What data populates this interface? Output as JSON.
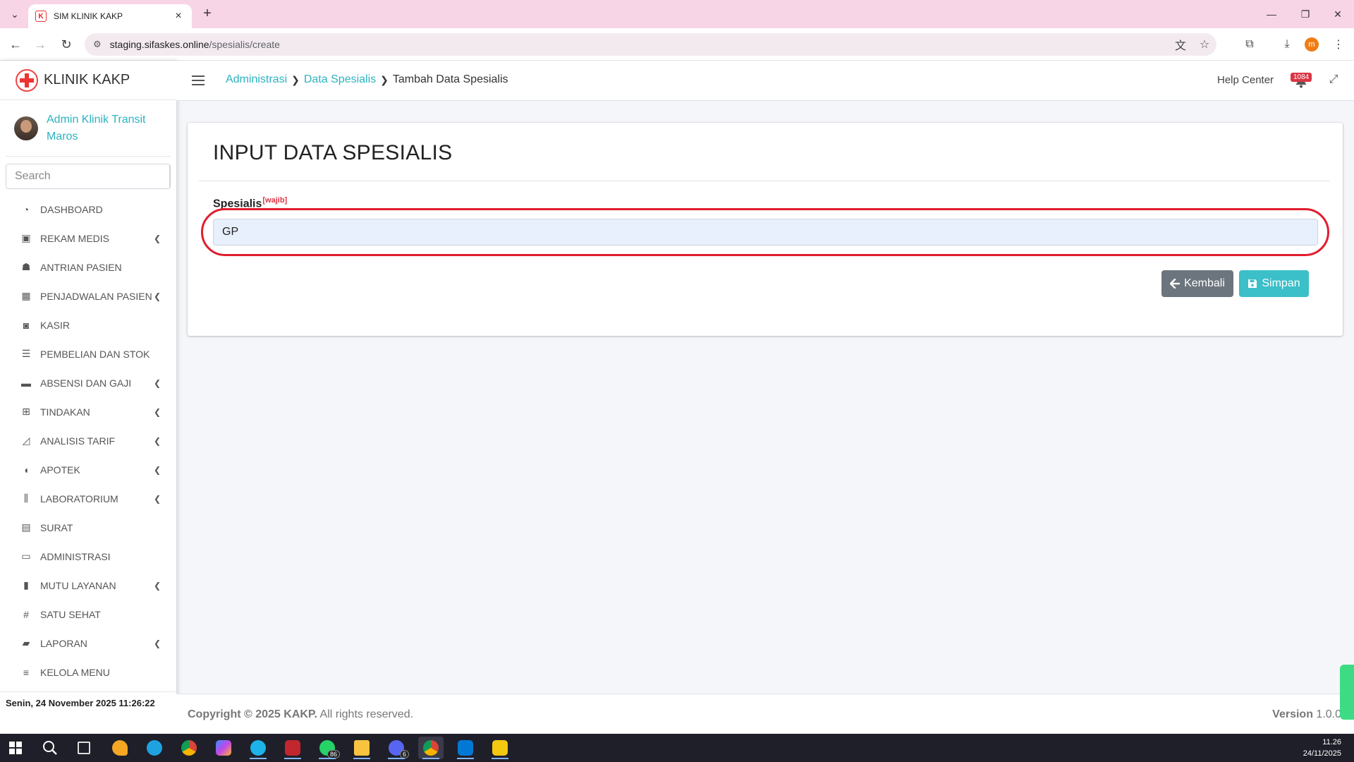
{
  "browser": {
    "tab_title": "SIM KLINIK KAKP",
    "favicon_text": "K",
    "url_host": "staging.sifaskes.online",
    "url_path": "/spesialis/create",
    "profile_initial": "m"
  },
  "sidebar": {
    "brand": "KLINIK KAKP",
    "user_name": "Admin Klinik Transit Maros",
    "search_placeholder": "Search",
    "items": [
      {
        "label": "DASHBOARD",
        "icon": "dashboard-icon",
        "chevron": false
      },
      {
        "label": "REKAM MEDIS",
        "icon": "medical-record-icon",
        "chevron": true
      },
      {
        "label": "ANTRIAN PASIEN",
        "icon": "queue-icon",
        "chevron": false
      },
      {
        "label": "PENJADWALAN PASIEN",
        "icon": "calendar-icon",
        "chevron": true
      },
      {
        "label": "KASIR",
        "icon": "cash-icon",
        "chevron": false
      },
      {
        "label": "PEMBELIAN DAN STOK",
        "icon": "list-icon",
        "chevron": false
      },
      {
        "label": "ABSENSI DAN GAJI",
        "icon": "wallet-icon",
        "chevron": true
      },
      {
        "label": "TINDAKAN",
        "icon": "medkit-icon",
        "chevron": true
      },
      {
        "label": "ANALISIS TARIF",
        "icon": "area-chart-icon",
        "chevron": true
      },
      {
        "label": "APOTEK",
        "icon": "pills-icon",
        "chevron": true
      },
      {
        "label": "LABORATORIUM",
        "icon": "lab-icon",
        "chevron": true
      },
      {
        "label": "SURAT",
        "icon": "document-icon",
        "chevron": false
      },
      {
        "label": "ADMINISTRASI",
        "icon": "id-card-icon",
        "chevron": false
      },
      {
        "label": "MUTU LAYANAN",
        "icon": "bar-chart-icon",
        "chevron": true
      },
      {
        "label": "SATU SEHAT",
        "icon": "hashtag-icon",
        "chevron": false
      },
      {
        "label": "LAPORAN",
        "icon": "folder-icon",
        "chevron": true
      },
      {
        "label": "KELOLA MENU",
        "icon": "menu-list-icon",
        "chevron": false
      }
    ],
    "datetime": "Senin, 24 November 2025 11:26:22"
  },
  "navbar": {
    "breadcrumb": [
      "Administrasi",
      "Data Spesialis",
      "Tambah Data Spesialis"
    ],
    "help_center": "Help Center",
    "notification_count": "1084"
  },
  "form": {
    "title": "INPUT DATA SPESIALIS",
    "field_label": "Spesialis",
    "field_required": "[wajib]",
    "field_value": "GP",
    "back_label": "Kembali",
    "save_label": "Simpan",
    "highlight_color": "#e11d2d"
  },
  "footer": {
    "copyright_prefix": "Copyright © 2025 KAKP.",
    "copyright_suffix": " All rights reserved.",
    "version_label": "Version",
    "version_value": " 1.0.0"
  },
  "taskbar": {
    "whatsapp_badge": "86",
    "discord_badge": "6",
    "time": "11.26",
    "date": "24/11/2025"
  }
}
